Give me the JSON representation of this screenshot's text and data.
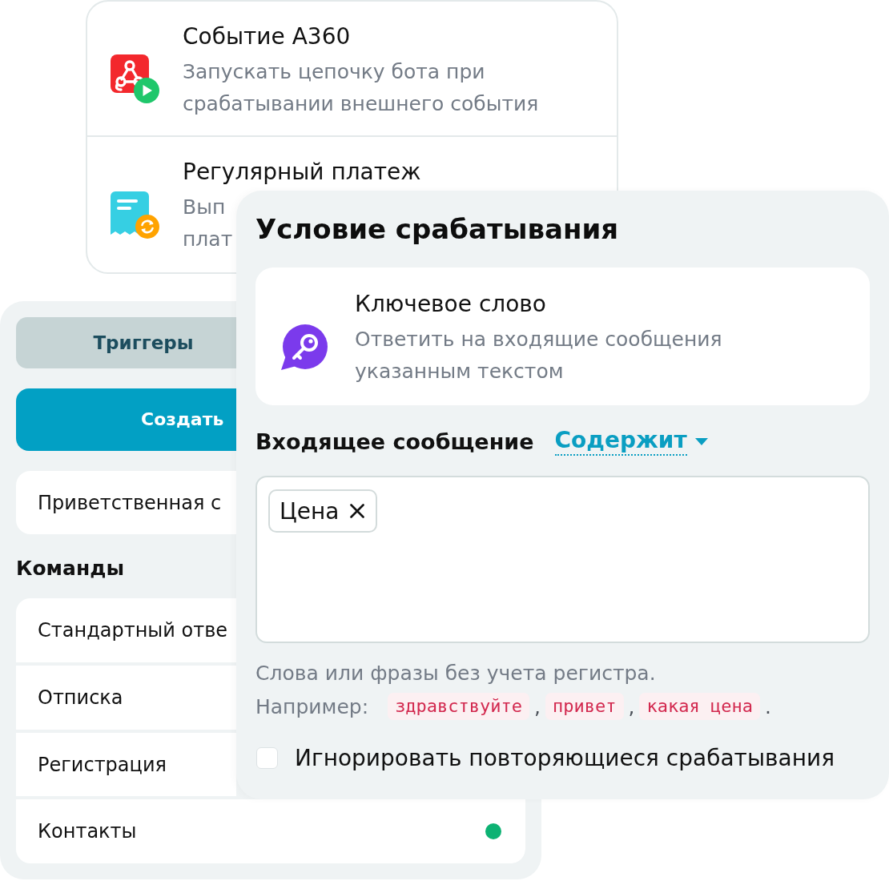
{
  "event_list": {
    "items": [
      {
        "kind": "webhook",
        "title": "Событие А360",
        "description_lines": [
          "Запускать цепочку бота при",
          "срабатывании внешнего события"
        ]
      },
      {
        "kind": "payment",
        "title": "Регулярный платеж",
        "description_lines": [
          "Вып",
          "плат"
        ]
      }
    ]
  },
  "sidebar": {
    "tabs": [
      {
        "label": "Триггеры",
        "selected": true
      }
    ],
    "create_button": "Создать",
    "trigger_items": [
      {
        "label": "Приветственная с"
      }
    ],
    "commands_heading": "Команды",
    "commands": [
      {
        "label": "Стандартный отве",
        "active": false
      },
      {
        "label": "Отписка",
        "active": false
      },
      {
        "label": "Регистрация",
        "active": false
      },
      {
        "label": "Контакты",
        "active": true
      }
    ]
  },
  "condition_panel": {
    "title": "Условие срабатывания",
    "trigger": {
      "kind": "keyword",
      "title": "Ключевое слово",
      "description_lines": [
        "Ответить на входящие сообщения",
        "указанным текстом"
      ]
    },
    "incoming_label": "Входящее сообщение",
    "match_mode": "Содержит",
    "keywords": [
      "Цена"
    ],
    "hint": "Слова или фразы без учета регистра.",
    "example_label": "Например:",
    "examples": [
      {
        "kind": "code",
        "text": "здравствуйте"
      },
      {
        "kind": "punct",
        "text": ","
      },
      {
        "kind": "code",
        "text": "привет"
      },
      {
        "kind": "punct",
        "text": ","
      },
      {
        "kind": "code",
        "text": "какая цена"
      },
      {
        "kind": "punct",
        "text": "."
      }
    ],
    "ignore_repeats": {
      "label": "Игнорировать повторяющиеся срабатывания",
      "checked": false
    }
  }
}
